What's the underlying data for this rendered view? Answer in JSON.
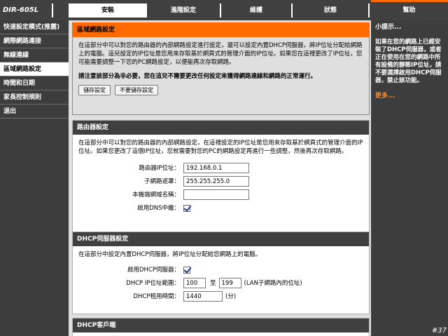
{
  "brand": "DIR-605L",
  "tabs": [
    "安裝",
    "進階設定",
    "維護",
    "狀態",
    "幫助"
  ],
  "sidebar": {
    "items": [
      {
        "label": "快速設定模式(推薦)"
      },
      {
        "label": "網際網路連接"
      },
      {
        "label": "無線連線"
      },
      {
        "label": "區域網路設定"
      },
      {
        "label": "時間和日期"
      },
      {
        "label": "家長控制規則"
      },
      {
        "label": "退出"
      }
    ]
  },
  "intro": {
    "title": "區域網路設定",
    "text": "在這部分中可以對您的路由器的內部網路設定進行設定，還可以設定內置DHCP伺服器，將IP位址分配給網路上的電腦。這兒設定的IP位址是您用來存取基於網頁式的管理介面的IP位址。如果您在這裡更改了IP位址，您可能需要調整一下您的PC網路設定，以便能再次存取網路。",
    "warning": "請注意該部分為非必要，您在這兒不需要更改任何設定來獲得網路連線和網路的正常運行。",
    "save_label": "儲存設定",
    "dont_save_label": "不要儲存設定"
  },
  "router": {
    "title": "路由器設定",
    "description": "在這部分中可以對您的路由器的內部網路設定。在這裡設定的IP位址是您用來存取基於網頁式的管理介面的IP位址。如果您更改了這個IP位址，您就需要對您的PC的網路設定再進行一些調整，然後再次存取網路。",
    "ip_label": "路由器IP位址：",
    "ip_value": "192.168.0.1",
    "mask_label": "子網路遮罩：",
    "mask_value": "255.255.255.0",
    "domain_label": "本機端網域名稱：",
    "domain_value": "",
    "dns_label": "啟用DNS中繼："
  },
  "dhcp": {
    "title": "DHCP伺服器設定",
    "description": "在這部分中設定內置DHCP伺服器，將IP位址分配給您網路上的電腦。",
    "enable_label": "啟用DHCP伺服器：",
    "range_label": "DHCP IP位址範圍：",
    "range_start": "100",
    "range_to": "至",
    "range_end": "199",
    "range_note": "(LAN子網路內的位址)",
    "lease_label": "DHCP租用時間：",
    "lease_value": "1440",
    "lease_unit": "(分)"
  },
  "dhcp_client": {
    "title": "DHCP客戶端"
  },
  "help": {
    "title": "小提示...",
    "text": "如果在您的網路上已經安裝了DHCP伺服器，或者正在使用在您的網路中所有設備的靜態IP位址，請不要選擇啟用DHCP伺服器，禁止該功能。",
    "more": "更多..."
  },
  "watermark": "#37"
}
